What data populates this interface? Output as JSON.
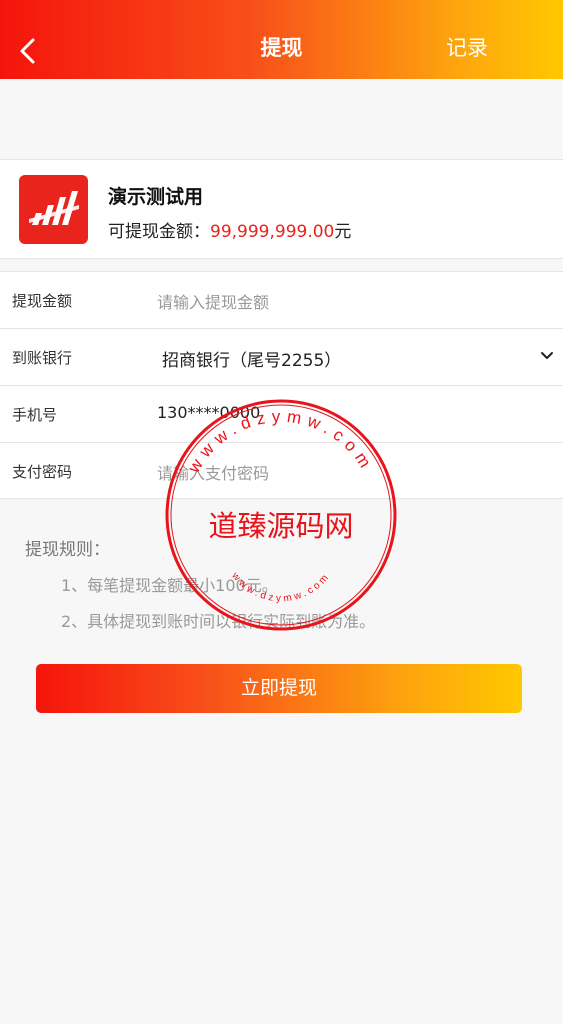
{
  "header": {
    "title": "提现",
    "right_label": "记录",
    "back_icon": "chevron-left-icon"
  },
  "user": {
    "name": "演示测试用",
    "balance_label": "可提现金额：",
    "balance_amount": "99,999,999.00",
    "balance_unit": "元"
  },
  "form": {
    "amount": {
      "label": "提现金额",
      "placeholder": "请输入提现金额"
    },
    "bank": {
      "label": "到账银行",
      "value": "招商银行（尾号2255）"
    },
    "phone": {
      "label": "手机号",
      "value": "130****0000"
    },
    "password": {
      "label": "支付密码",
      "placeholder": "请输入支付密码"
    }
  },
  "rules": {
    "title": "提现规则：",
    "items": [
      "1、每笔提现金额最小100元。",
      "2、具体提现到账时间以银行实际到账为准。"
    ]
  },
  "submit_label": "立即提现",
  "watermark": {
    "text": "道臻源码网",
    "site": "www.dzymw.com",
    "color": "#e8141b"
  },
  "colors": {
    "accent": "#e8241c",
    "gradient_start": "#f5140b",
    "gradient_end": "#ffc800"
  }
}
